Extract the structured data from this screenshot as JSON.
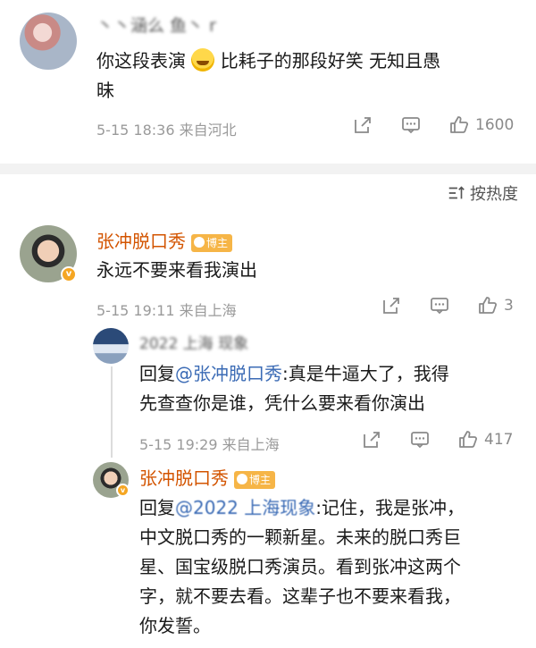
{
  "comment1": {
    "author": "丶丶涵么 鱼丶 r",
    "text_before": "你这段表演",
    "text_after": "比耗子的那段好笑 无知且愚",
    "text_line2": "昧",
    "time": "5-15 18:36 来自河北",
    "likes": "1600"
  },
  "sort": {
    "label": "按热度"
  },
  "comment2": {
    "author": "张冲脱口秀",
    "tag": "博主",
    "text": "永远不要来看我演出",
    "time": "5-15 19:11 来自上海",
    "likes": "3"
  },
  "reply1": {
    "author": "2022 上海 现象",
    "prefix": "回复",
    "mention": "@张冲脱口秀",
    "line1": ":真是牛逼大了，我得",
    "line2": "先查查你是谁，凭什么要来看你演出",
    "time": "5-15 19:29 来自上海",
    "likes": "417"
  },
  "reply2": {
    "author": "张冲脱口秀",
    "tag": "博主",
    "prefix": "回复",
    "mention": "@2022 上海现象",
    "line1": ":记住，我是张冲，",
    "line2": "中文脱口秀的一颗新星。未来的脱口秀巨",
    "line3": "星、国宝级脱口秀演员。看到张冲这两个",
    "line4": "字，就不要去看。这辈子也不要来看我，",
    "line5": "你发誓。"
  },
  "icons": {
    "share": "share-icon",
    "comment": "comment-icon",
    "like": "thumbs-up-icon",
    "sort": "sort-icon",
    "verified": "verified-badge-icon"
  }
}
